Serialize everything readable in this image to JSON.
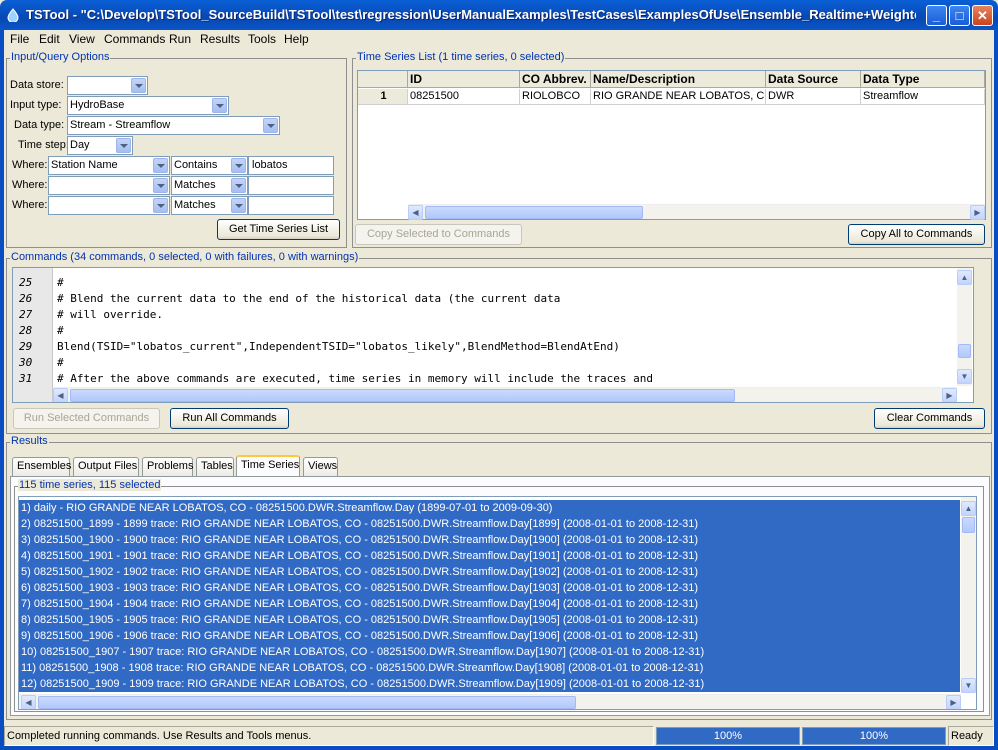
{
  "window": {
    "title": "TSTool - \"C:\\Develop\\TSTool_SourceBuild\\TSTool\\test\\regression\\UserManualExamples\\TestCases\\ExamplesOfUse\\Ensemble_Realtime+Weighte..."
  },
  "menu": [
    "File",
    "Edit",
    "View",
    "Commands",
    "Run",
    "Results",
    "Tools",
    "Help"
  ],
  "query": {
    "legend": "Input/Query Options",
    "datastore_label": "Data store:",
    "datastore_value": "",
    "input_type_label": "Input type:",
    "input_type_value": "HydroBase",
    "data_type_label": "Data type:",
    "data_type_value": "Stream - Streamflow",
    "time_step_label": "Time step:",
    "time_step_value": "Day",
    "where": [
      {
        "label": "Where:",
        "field": "Station Name",
        "op": "Contains",
        "value": "lobatos"
      },
      {
        "label": "Where:",
        "field": "",
        "op": "Matches",
        "value": ""
      },
      {
        "label": "Where:",
        "field": "",
        "op": "Matches",
        "value": ""
      }
    ],
    "get_button": "Get Time Series List"
  },
  "tslist": {
    "legend": "Time Series List (1 time series, 0 selected)",
    "columns": [
      "ID",
      "CO Abbrev.",
      "Name/Description",
      "Data Source",
      "Data Type"
    ],
    "rows": [
      {
        "num": "1",
        "cells": [
          "08251500",
          "RIOLOBCO",
          "RIO GRANDE NEAR LOBATOS, CO",
          "DWR",
          "Streamflow"
        ]
      }
    ],
    "copy_selected": "Copy Selected to Commands",
    "copy_all": "Copy All to Commands"
  },
  "commands": {
    "legend": "Commands (34 commands, 0 selected, 0 with failures, 0 with warnings)",
    "lines": [
      {
        "n": "25",
        "t": "#"
      },
      {
        "n": "26",
        "t": "# Blend the current data to the end of the historical data (the current data"
      },
      {
        "n": "27",
        "t": "# will override."
      },
      {
        "n": "28",
        "t": "#"
      },
      {
        "n": "29",
        "t": "Blend(TSID=\"lobatos_current\",IndependentTSID=\"lobatos_likely\",BlendMethod=BlendAtEnd)"
      },
      {
        "n": "30",
        "t": "#"
      },
      {
        "n": "31",
        "t": "# After the above commands are executed, time series in memory will include the traces and"
      }
    ],
    "run_selected": "Run Selected Commands",
    "run_all": "Run All Commands",
    "clear": "Clear Commands"
  },
  "results": {
    "legend": "Results",
    "tabs": [
      "Ensembles",
      "Output Files",
      "Problems",
      "Tables",
      "Time Series",
      "Views"
    ],
    "selected_tab": "Time Series",
    "list_legend": "115 time series, 115 selected",
    "items": [
      "1) daily - RIO GRANDE NEAR LOBATOS, CO - 08251500.DWR.Streamflow.Day (1899-07-01 to 2009-09-30)",
      "2) 08251500_1899 - 1899 trace: RIO GRANDE NEAR LOBATOS, CO - 08251500.DWR.Streamflow.Day[1899] (2008-01-01 to 2008-12-31)",
      "3) 08251500_1900 - 1900 trace: RIO GRANDE NEAR LOBATOS, CO - 08251500.DWR.Streamflow.Day[1900] (2008-01-01 to 2008-12-31)",
      "4) 08251500_1901 - 1901 trace: RIO GRANDE NEAR LOBATOS, CO - 08251500.DWR.Streamflow.Day[1901] (2008-01-01 to 2008-12-31)",
      "5) 08251500_1902 - 1902 trace: RIO GRANDE NEAR LOBATOS, CO - 08251500.DWR.Streamflow.Day[1902] (2008-01-01 to 2008-12-31)",
      "6) 08251500_1903 - 1903 trace: RIO GRANDE NEAR LOBATOS, CO - 08251500.DWR.Streamflow.Day[1903] (2008-01-01 to 2008-12-31)",
      "7) 08251500_1904 - 1904 trace: RIO GRANDE NEAR LOBATOS, CO - 08251500.DWR.Streamflow.Day[1904] (2008-01-01 to 2008-12-31)",
      "8) 08251500_1905 - 1905 trace: RIO GRANDE NEAR LOBATOS, CO - 08251500.DWR.Streamflow.Day[1905] (2008-01-01 to 2008-12-31)",
      "9) 08251500_1906 - 1906 trace: RIO GRANDE NEAR LOBATOS, CO - 08251500.DWR.Streamflow.Day[1906] (2008-01-01 to 2008-12-31)",
      "10) 08251500_1907 - 1907 trace: RIO GRANDE NEAR LOBATOS, CO - 08251500.DWR.Streamflow.Day[1907] (2008-01-01 to 2008-12-31)",
      "11) 08251500_1908 - 1908 trace: RIO GRANDE NEAR LOBATOS, CO - 08251500.DWR.Streamflow.Day[1908] (2008-01-01 to 2008-12-31)",
      "12) 08251500_1909 - 1909 trace: RIO GRANDE NEAR LOBATOS, CO - 08251500.DWR.Streamflow.Day[1909] (2008-01-01 to 2008-12-31)"
    ]
  },
  "status": {
    "message": "Completed running commands.  Use Results and Tools menus.",
    "progress1": "100%",
    "progress2": "100%",
    "state": "Ready"
  },
  "colors": {
    "selection": "#316ac5",
    "legend": "#0033b0",
    "titlebar": "#0a5fd6"
  }
}
